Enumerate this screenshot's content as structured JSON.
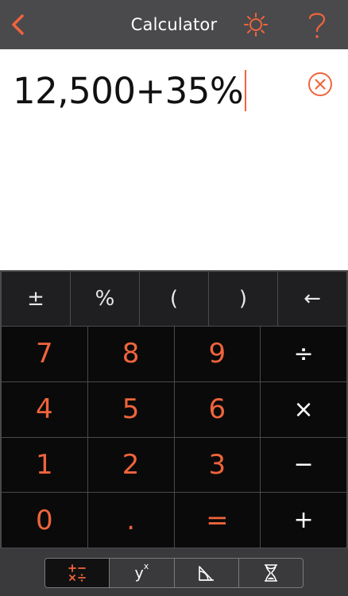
{
  "header": {
    "title": "Calculator",
    "back_icon": "chevron-left-icon",
    "theme_icon": "sun-icon",
    "help_icon": "question-mark-icon",
    "accent": "#f0643c"
  },
  "display": {
    "expression": "12,500+35%",
    "clear_icon": "clear-circle-icon"
  },
  "keypad": {
    "function_row": [
      "±",
      "%",
      "(",
      ")",
      "←"
    ],
    "rows": [
      [
        "7",
        "8",
        "9",
        "÷"
      ],
      [
        "4",
        "5",
        "6",
        "×"
      ],
      [
        "1",
        "2",
        "3",
        "−"
      ],
      [
        "0",
        ".",
        "=",
        "+"
      ]
    ]
  },
  "tabs": {
    "items": [
      {
        "name": "basic-operations-icon",
        "active": true
      },
      {
        "label": "y",
        "superscript": "x",
        "active": false
      },
      {
        "name": "geometry-icon",
        "active": false
      },
      {
        "name": "hourglass-icon",
        "active": false
      }
    ]
  },
  "colors": {
    "accent": "#f0643c",
    "header_bg": "#4a4a4c",
    "key_bg": "#0a0a0a",
    "function_key_bg": "#1f1f21"
  }
}
